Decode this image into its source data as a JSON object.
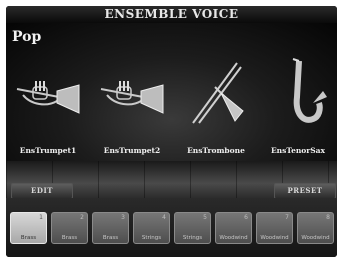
{
  "title": "ENSEMBLE VOICE",
  "category": "Pop",
  "instruments": [
    {
      "name": "EnsTrumpet1",
      "icon": "trumpet-icon"
    },
    {
      "name": "EnsTrumpet2",
      "icon": "trumpet-icon"
    },
    {
      "name": "EnsTrombone",
      "icon": "trombone-icon"
    },
    {
      "name": "EnsTenorSax",
      "icon": "saxophone-icon"
    }
  ],
  "buttons": {
    "edit": "EDIT",
    "preset": "PRESET"
  },
  "slots": [
    {
      "num": "1",
      "label": "Brass",
      "active": true
    },
    {
      "num": "2",
      "label": "Brass",
      "active": false
    },
    {
      "num": "3",
      "label": "Brass",
      "active": false
    },
    {
      "num": "4",
      "label": "Strings",
      "active": false
    },
    {
      "num": "5",
      "label": "Strings",
      "active": false
    },
    {
      "num": "6",
      "label": "Woodwind",
      "active": false
    },
    {
      "num": "7",
      "label": "Woodwind",
      "active": false
    },
    {
      "num": "8",
      "label": "Woodwind",
      "active": false
    }
  ]
}
